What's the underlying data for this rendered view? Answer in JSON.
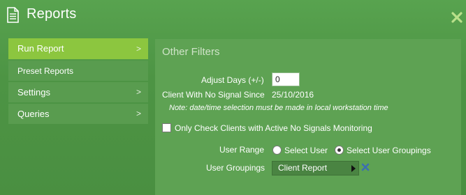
{
  "window": {
    "title": "Reports",
    "icon": "document-icon",
    "close_icon": "close-icon"
  },
  "sidebar": {
    "items": [
      {
        "label": "Run Report",
        "chevron": ">",
        "active": true
      },
      {
        "label": "Preset Reports",
        "chevron": "",
        "active": false
      },
      {
        "label": "Settings",
        "chevron": ">",
        "active": false
      },
      {
        "label": "Queries",
        "chevron": ">",
        "active": false
      }
    ]
  },
  "panel": {
    "title": "Other Filters",
    "adjust_days": {
      "label": "Adjust Days (+/-)",
      "value": "0"
    },
    "no_signal_since": {
      "label": "Client With No Signal Since",
      "value": "25/10/2016"
    },
    "note": "Note: date/time selection must be made in local workstation time",
    "active_monitoring": {
      "label": "Only Check Clients with Active No Signals Monitoring",
      "checked": false
    },
    "user_range": {
      "label": "User Range",
      "options": [
        {
          "label": "Select User",
          "checked": false
        },
        {
          "label": "Select User Groupings",
          "checked": true
        }
      ]
    },
    "user_groupings": {
      "label": "User Groupings",
      "selected": "Client Report"
    }
  },
  "colors": {
    "background": "#4d9444",
    "active_item": "#8cc63f",
    "sidebar_item": "#599c4f",
    "panel": "#5ea253",
    "close_icon": "#b9e08a",
    "remove_icon": "#3b6fb0"
  }
}
